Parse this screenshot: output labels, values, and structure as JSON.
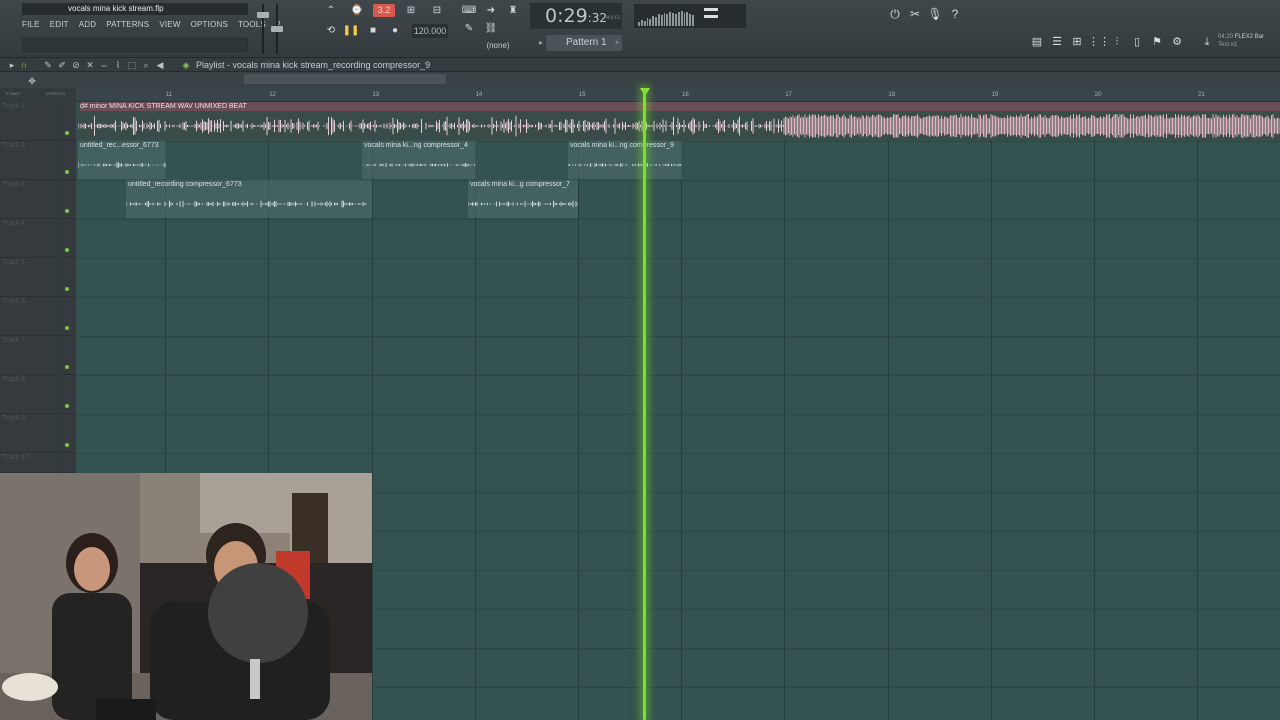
{
  "window": {
    "file_name": "vocals mina kick stream.flp"
  },
  "menu": {
    "items": [
      "FILE",
      "EDIT",
      "ADD",
      "PATTERNS",
      "VIEW",
      "OPTIONS",
      "TOOLS",
      "?"
    ]
  },
  "transport": {
    "song_position": "3.2",
    "tempo": "120.000",
    "time_main": "0:29",
    "time_ms": ":32",
    "time_unit": "M:S:CS",
    "snap": "(none)",
    "pattern": "Pattern 1"
  },
  "plugin": {
    "line1": "04:20",
    "name": "FLEX2 Bar",
    "preset": "Test #1"
  },
  "playlist": {
    "title": "Playlist - vocals mina kick stream_recording compressor_9",
    "ruler": [
      "11",
      "12",
      "13",
      "14",
      "15",
      "16",
      "17",
      "18",
      "19",
      "20",
      "21"
    ],
    "corner_left": "F-SNCF",
    "corner_right": "STRETCH",
    "tracks": [
      "Track 1",
      "Track 2",
      "Track 3",
      "Track 4",
      "Track 5",
      "Track 6",
      "Track 7",
      "Track 8",
      "Track 9",
      "Track 10"
    ],
    "clips": {
      "beat": "d# minor MINA KICK STREAM WAV UNMIXED BEAT",
      "t2a": "untitled_rec...essor_6773",
      "t2b": "vocals mina ki...ng compressor_4",
      "t2c": "vocals mina ki...ng compressor_9",
      "t3a": "untitled_recording compressor_6773",
      "t3b": "vocals mina ki...g compressor_7"
    }
  },
  "colors": {
    "grid": "#34524f",
    "playhead": "#7fe02a",
    "beat_clip": "#6b4d58",
    "song_position": "#d8584d"
  }
}
